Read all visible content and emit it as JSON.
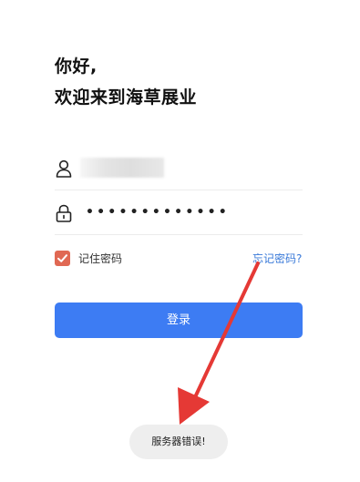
{
  "greeting": {
    "line1": "你好,",
    "line2": "欢迎来到海草展业"
  },
  "username_field": {
    "icon": "user-icon",
    "value": "user"
  },
  "password_field": {
    "icon": "lock-icon",
    "masked_value": "•••••••••••••"
  },
  "remember": {
    "checked": true,
    "label": "记住密码"
  },
  "forgot_password_label": "忘记密码?",
  "login_button_label": "登录",
  "toast": {
    "message": "服务器错误!"
  },
  "colors": {
    "primary": "#3d7cf3",
    "checkbox": "#e06853",
    "link": "#3a7ad9",
    "annotation_arrow": "#e53935",
    "toast_bg": "#eeeeee"
  }
}
